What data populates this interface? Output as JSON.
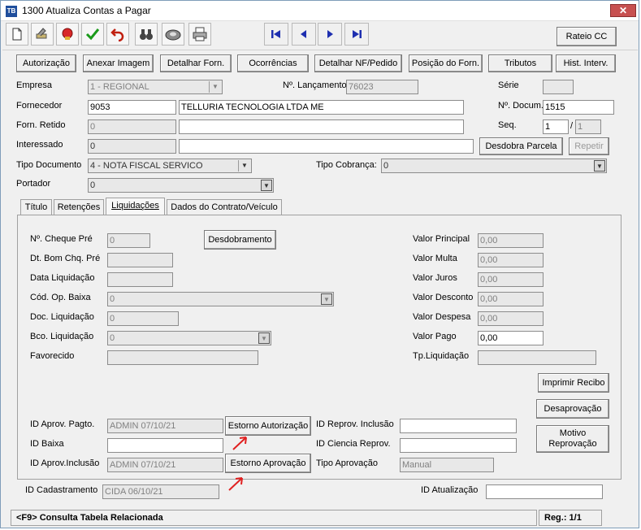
{
  "window": {
    "title": "1300 Atualiza Contas a Pagar",
    "app_icon": "TB",
    "close": "✕"
  },
  "toolbar": {
    "icons": [
      "new-document-icon",
      "tools-icon",
      "seal-icon",
      "check-icon",
      "undo-icon",
      "binoculars-icon",
      "disk-icon",
      "printer-icon"
    ],
    "rateio_label": "Rateio CC"
  },
  "buttons": {
    "autorizacao": "Autorização",
    "anexar_imagem": "Anexar Imagem",
    "detalhar_forn": "Detalhar Forn.",
    "ocorrencias": "Ocorrências",
    "detalhar_nf": "Detalhar NF/Pedido",
    "posicao_forn": "Posição do Forn.",
    "tributos": "Tributos",
    "hist_interv": "Hist. Interv.",
    "desdobra_parcela": "Desdobra Parcela",
    "repetir": "Repetir"
  },
  "form": {
    "empresa_label": "Empresa",
    "empresa_value": "1 - REGIONAL",
    "lancamento_label": "Nº. Lançamento",
    "lancamento_value": "76023",
    "serie_label": "Série",
    "serie_value": "",
    "fornecedor_label": "Fornecedor",
    "fornecedor_code": "9053",
    "fornecedor_name": "TELLURIA TECNOLOGIA LTDA ME",
    "documento_label": "Nº. Docum.",
    "documento_value": "1515",
    "forn_retido_label": "Forn. Retido",
    "forn_retido_code": "0",
    "forn_retido_name": "",
    "seq_label": "Seq.",
    "seq_value": "1",
    "seq_sep": "/",
    "seq_total": "1",
    "interessado_label": "Interessado",
    "interessado_code": "0",
    "interessado_name": "",
    "tipo_documento_label": "Tipo Documento",
    "tipo_documento_value": "4 - NOTA FISCAL SERVICO",
    "tipo_cobranca_label": "Tipo Cobrança:",
    "tipo_cobranca_value": "0",
    "portador_label": "Portador",
    "portador_value": "0"
  },
  "tabs": [
    {
      "label": "Título"
    },
    {
      "label": "Retenções"
    },
    {
      "label": "Liquidações"
    },
    {
      "label": "Dados do Contrato/Veículo"
    }
  ],
  "liquidacoes": {
    "cheque_pre_label": "Nº. Cheque Pré",
    "cheque_pre_value": "0",
    "desdobramento_label": "Desdobramento",
    "dt_bom_label": "Dt. Bom Chq. Pré",
    "dt_bom_value": "",
    "data_liq_label": "Data Liquidação",
    "data_liq_value": "",
    "cod_op_label": "Cód. Op. Baixa",
    "cod_op_value": "0",
    "doc_liq_label": "Doc. Liquidação",
    "doc_liq_value": "0",
    "bco_liq_label": "Bco. Liquidação",
    "bco_liq_value": "0",
    "favorecido_label": "Favorecido",
    "favorecido_value": "",
    "valor_principal_label": "Valor Principal",
    "valor_principal_value": "0,00",
    "valor_multa_label": "Valor Multa",
    "valor_multa_value": "0,00",
    "valor_juros_label": "Valor Juros",
    "valor_juros_value": "0,00",
    "valor_desconto_label": "Valor Desconto",
    "valor_desconto_value": "0,00",
    "valor_despesa_label": "Valor Despesa",
    "valor_despesa_value": "0,00",
    "valor_pago_label": "Valor Pago",
    "valor_pago_value": "0,00",
    "tp_liquidacao_label": "Tp.Liquidação",
    "tp_liquidacao_value": "",
    "imprimir_recibo": "Imprimir Recibo",
    "desaprovacao": "Desaprovação",
    "motivo_line1": "Motivo",
    "motivo_line2": "Reprovação",
    "id_aprov_pagto_label": "ID Aprov. Pagto.",
    "id_aprov_pagto_value": "ADMIN 07/10/21",
    "estorno_autorizacao": "Estorno Autorização",
    "id_reprov_inclusao_label": "ID Reprov. Inclusão",
    "id_reprov_inclusao_value": "",
    "id_baixa_label": "ID Baixa",
    "id_baixa_value": "",
    "id_ciencia_label": "ID Ciencia Reprov.",
    "id_ciencia_value": "",
    "id_aprov_inclusao_label": "ID Aprov.Inclusão",
    "id_aprov_inclusao_value": "ADMIN 07/10/21",
    "estorno_aprovacao": "Estorno Aprovação",
    "tipo_aprovacao_label": "Tipo Aprovação",
    "tipo_aprovacao_value": "Manual"
  },
  "footer": {
    "id_cadastramento_label": "ID Cadastramento",
    "id_cadastramento_value": "CIDA 06/10/21",
    "id_atualizacao_label": "ID Atualização",
    "id_atualizacao_value": ""
  },
  "status": {
    "hint": "<F9> Consulta Tabela Relacionada",
    "reg": "Reg.: 1/1"
  }
}
